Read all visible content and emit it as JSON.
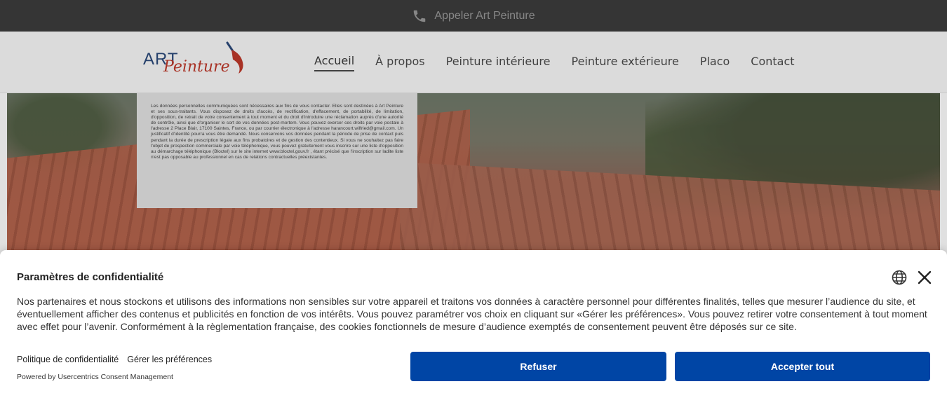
{
  "callbar": {
    "label": "Appeler Art Peinture",
    "icon": "phone-icon"
  },
  "logo": {
    "part1": "ART",
    "part2": "Peinture"
  },
  "nav": {
    "items": [
      {
        "label": "Accueil",
        "active": true
      },
      {
        "label": "À propos"
      },
      {
        "label": "Peinture intérieure"
      },
      {
        "label": "Peinture extérieure"
      },
      {
        "label": "Placo"
      },
      {
        "label": "Contact"
      }
    ]
  },
  "legal": {
    "text": "Les données personnelles communiquées sont nécessaires aux fins de vous contacter. Elles sont destinées à Art Peinture et ses sous-traitants. Vous disposez de droits d'accès, de rectification, d'effacement, de portabilité, de limitation, d'opposition, de retrait de votre consentement à tout moment et du droit d'introduire une réclamation auprès d'une autorité de contrôle, ainsi que d'organiser le sort de vos données post-mortem. Vous pouvez exercer ces droits par voie postale à l'adresse 2 Place Blair, 17100 Saintes, France, ou par courrier électronique à l'adresse harancourt.wilfried@gmail.com. Un justificatif d'identité pourra vous être demandé. Nous conservons vos données pendant la période de prise de contact puis pendant la durée de prescription légale aux fins probatoires et de gestion des contentieux. Si vous ne souhaitez pas faire l'objet de prospection commerciale par voie téléphonique, vous pouvez gratuitement vous inscrire sur une liste d'opposition au démarchage téléphonique (Bloctel) sur le site internet www.bloctel.gouv.fr , étant précisé que l'inscription sur ladite liste n'est pas opposable au professionnel en cas de relations contractuelles préexistantes."
  },
  "consent": {
    "title": "Paramètres de confidentialité",
    "text": "Nos partenaires et nous stockons et utilisons des informations non sensibles sur votre appareil et traitons vos données à caractère personnel pour différentes finalités, telles que mesurer l’audience du site, et éventuellement afficher des contenus et publicités en fonction de vos intérêts. Vous pouvez paramétrer vos choix en cliquant sur «Gérer les préférences». Vous pouvez retirer votre consentement à tout moment avec effet pour l’avenir. Conformément à la règlementation française, des cookies fonctionnels de mesure d’audience exemptés de consentement peuvent être déposés sur ce site.",
    "link_privacy": "Politique de confidentialité",
    "link_prefs": "Gérer les préférences",
    "powered": "Powered by Usercentrics Consent Management",
    "btn_refuse": "Refuser",
    "btn_accept": "Accepter tout",
    "button_color": "#0045a5"
  }
}
